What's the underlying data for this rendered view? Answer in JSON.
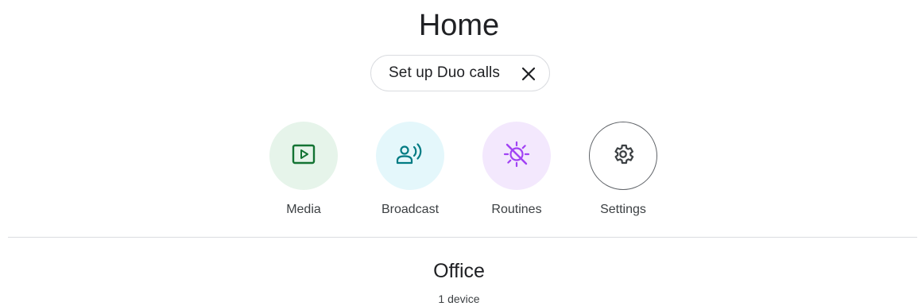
{
  "header": {
    "title": "Home"
  },
  "chip": {
    "label": "Set up Duo calls",
    "close_icon": "close-icon"
  },
  "actions": [
    {
      "label": "Media",
      "icon": "play-box-icon",
      "bg": "#e6f4ea",
      "fg": "#137333"
    },
    {
      "label": "Broadcast",
      "icon": "broadcast-person-icon",
      "bg": "#e4f7fb",
      "fg": "#007b83"
    },
    {
      "label": "Routines",
      "icon": "sun-off-icon",
      "bg": "#f3e8fd",
      "fg": "#a142f4"
    },
    {
      "label": "Settings",
      "icon": "gear-icon",
      "bg": "#ffffff",
      "fg": "#3c4043"
    }
  ],
  "room": {
    "name": "Office",
    "devices": "1 device"
  }
}
